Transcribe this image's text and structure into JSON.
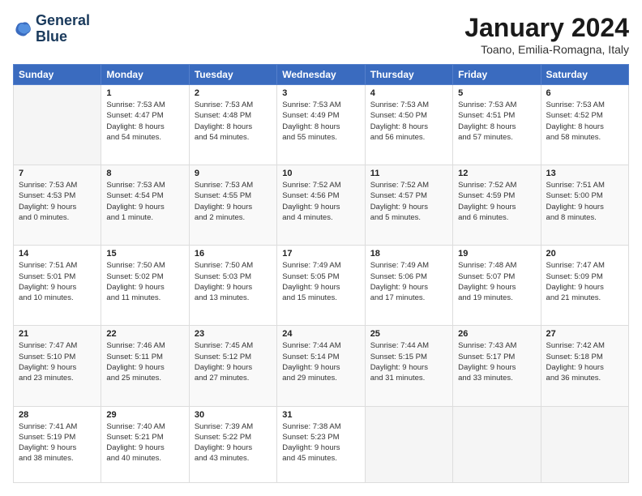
{
  "logo": {
    "line1": "General",
    "line2": "Blue"
  },
  "title": "January 2024",
  "subtitle": "Toano, Emilia-Romagna, Italy",
  "days_of_week": [
    "Sunday",
    "Monday",
    "Tuesday",
    "Wednesday",
    "Thursday",
    "Friday",
    "Saturday"
  ],
  "weeks": [
    [
      {
        "day": "",
        "info": ""
      },
      {
        "day": "1",
        "info": "Sunrise: 7:53 AM\nSunset: 4:47 PM\nDaylight: 8 hours\nand 54 minutes."
      },
      {
        "day": "2",
        "info": "Sunrise: 7:53 AM\nSunset: 4:48 PM\nDaylight: 8 hours\nand 54 minutes."
      },
      {
        "day": "3",
        "info": "Sunrise: 7:53 AM\nSunset: 4:49 PM\nDaylight: 8 hours\nand 55 minutes."
      },
      {
        "day": "4",
        "info": "Sunrise: 7:53 AM\nSunset: 4:50 PM\nDaylight: 8 hours\nand 56 minutes."
      },
      {
        "day": "5",
        "info": "Sunrise: 7:53 AM\nSunset: 4:51 PM\nDaylight: 8 hours\nand 57 minutes."
      },
      {
        "day": "6",
        "info": "Sunrise: 7:53 AM\nSunset: 4:52 PM\nDaylight: 8 hours\nand 58 minutes."
      }
    ],
    [
      {
        "day": "7",
        "info": "Sunrise: 7:53 AM\nSunset: 4:53 PM\nDaylight: 9 hours\nand 0 minutes."
      },
      {
        "day": "8",
        "info": "Sunrise: 7:53 AM\nSunset: 4:54 PM\nDaylight: 9 hours\nand 1 minute."
      },
      {
        "day": "9",
        "info": "Sunrise: 7:53 AM\nSunset: 4:55 PM\nDaylight: 9 hours\nand 2 minutes."
      },
      {
        "day": "10",
        "info": "Sunrise: 7:52 AM\nSunset: 4:56 PM\nDaylight: 9 hours\nand 4 minutes."
      },
      {
        "day": "11",
        "info": "Sunrise: 7:52 AM\nSunset: 4:57 PM\nDaylight: 9 hours\nand 5 minutes."
      },
      {
        "day": "12",
        "info": "Sunrise: 7:52 AM\nSunset: 4:59 PM\nDaylight: 9 hours\nand 6 minutes."
      },
      {
        "day": "13",
        "info": "Sunrise: 7:51 AM\nSunset: 5:00 PM\nDaylight: 9 hours\nand 8 minutes."
      }
    ],
    [
      {
        "day": "14",
        "info": "Sunrise: 7:51 AM\nSunset: 5:01 PM\nDaylight: 9 hours\nand 10 minutes."
      },
      {
        "day": "15",
        "info": "Sunrise: 7:50 AM\nSunset: 5:02 PM\nDaylight: 9 hours\nand 11 minutes."
      },
      {
        "day": "16",
        "info": "Sunrise: 7:50 AM\nSunset: 5:03 PM\nDaylight: 9 hours\nand 13 minutes."
      },
      {
        "day": "17",
        "info": "Sunrise: 7:49 AM\nSunset: 5:05 PM\nDaylight: 9 hours\nand 15 minutes."
      },
      {
        "day": "18",
        "info": "Sunrise: 7:49 AM\nSunset: 5:06 PM\nDaylight: 9 hours\nand 17 minutes."
      },
      {
        "day": "19",
        "info": "Sunrise: 7:48 AM\nSunset: 5:07 PM\nDaylight: 9 hours\nand 19 minutes."
      },
      {
        "day": "20",
        "info": "Sunrise: 7:47 AM\nSunset: 5:09 PM\nDaylight: 9 hours\nand 21 minutes."
      }
    ],
    [
      {
        "day": "21",
        "info": "Sunrise: 7:47 AM\nSunset: 5:10 PM\nDaylight: 9 hours\nand 23 minutes."
      },
      {
        "day": "22",
        "info": "Sunrise: 7:46 AM\nSunset: 5:11 PM\nDaylight: 9 hours\nand 25 minutes."
      },
      {
        "day": "23",
        "info": "Sunrise: 7:45 AM\nSunset: 5:12 PM\nDaylight: 9 hours\nand 27 minutes."
      },
      {
        "day": "24",
        "info": "Sunrise: 7:44 AM\nSunset: 5:14 PM\nDaylight: 9 hours\nand 29 minutes."
      },
      {
        "day": "25",
        "info": "Sunrise: 7:44 AM\nSunset: 5:15 PM\nDaylight: 9 hours\nand 31 minutes."
      },
      {
        "day": "26",
        "info": "Sunrise: 7:43 AM\nSunset: 5:17 PM\nDaylight: 9 hours\nand 33 minutes."
      },
      {
        "day": "27",
        "info": "Sunrise: 7:42 AM\nSunset: 5:18 PM\nDaylight: 9 hours\nand 36 minutes."
      }
    ],
    [
      {
        "day": "28",
        "info": "Sunrise: 7:41 AM\nSunset: 5:19 PM\nDaylight: 9 hours\nand 38 minutes."
      },
      {
        "day": "29",
        "info": "Sunrise: 7:40 AM\nSunset: 5:21 PM\nDaylight: 9 hours\nand 40 minutes."
      },
      {
        "day": "30",
        "info": "Sunrise: 7:39 AM\nSunset: 5:22 PM\nDaylight: 9 hours\nand 43 minutes."
      },
      {
        "day": "31",
        "info": "Sunrise: 7:38 AM\nSunset: 5:23 PM\nDaylight: 9 hours\nand 45 minutes."
      },
      {
        "day": "",
        "info": ""
      },
      {
        "day": "",
        "info": ""
      },
      {
        "day": "",
        "info": ""
      }
    ]
  ]
}
